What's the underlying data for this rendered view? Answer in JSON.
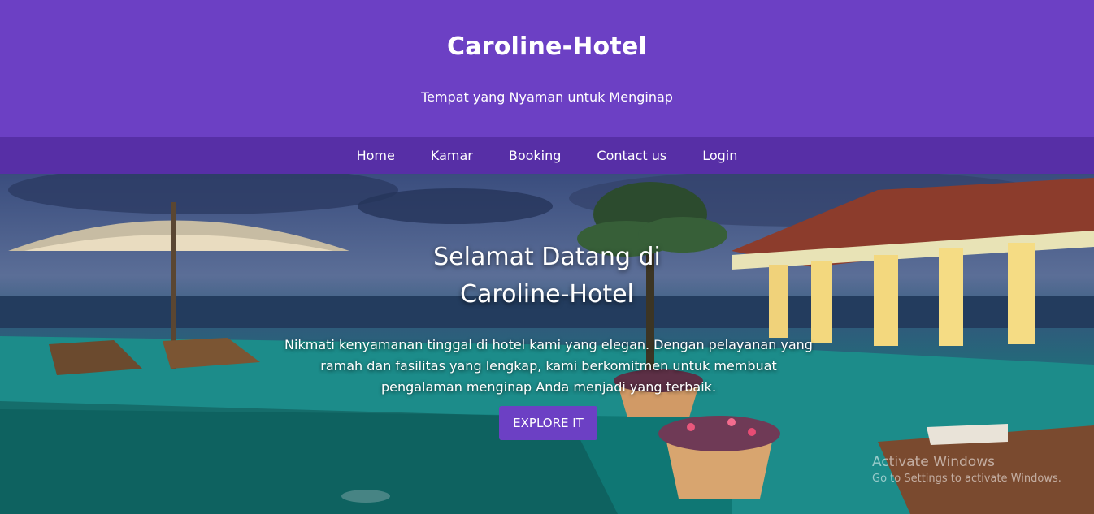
{
  "header": {
    "brand": "Caroline-Hotel",
    "tagline": "Tempat yang Nyaman untuk Menginap"
  },
  "nav": {
    "items": [
      {
        "label": "Home"
      },
      {
        "label": "Kamar"
      },
      {
        "label": "Booking"
      },
      {
        "label": "Contact us"
      },
      {
        "label": "Login"
      }
    ]
  },
  "hero": {
    "title_line1": "Selamat Datang di",
    "title_line2": "Caroline-Hotel",
    "description": "Nikmati kenyamanan tinggal di hotel kami yang elegan. Dengan pelayanan yang ramah dan fasilitas yang lengkap, kami berkomitmen untuk membuat pengalaman menginap Anda menjadi yang terbaik.",
    "button_label": "EXPLORE IT"
  },
  "watermark": {
    "title": "Activate Windows",
    "subtitle": "Go to Settings to activate Windows."
  },
  "colors": {
    "header_bg": "#6c40c4",
    "nav_bg": "#572fa6",
    "button_bg": "#6c40c4"
  }
}
